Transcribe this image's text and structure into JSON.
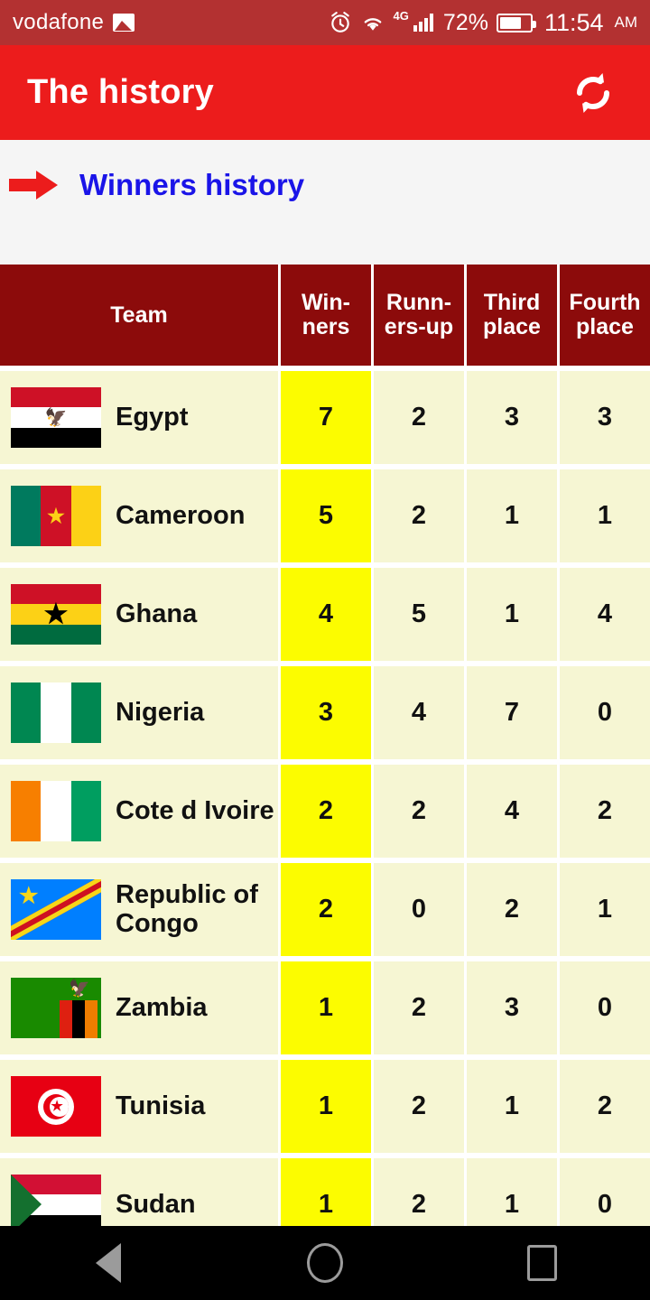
{
  "status_bar": {
    "carrier": "vodafone",
    "photo_icon": "photo-icon",
    "alarm_icon": "alarm-icon",
    "wifi_icon": "wifi-icon",
    "network_type": "4G",
    "signal_icon": "signal-bars-icon",
    "battery_percent": "72%",
    "battery_icon": "battery-icon",
    "time": "11:54",
    "meridiem": "AM"
  },
  "app_bar": {
    "title": "The history",
    "refresh_icon": "refresh-icon"
  },
  "section": {
    "arrow_icon": "right-arrow-icon",
    "title": "Winners history",
    "title_color": "#1a14e8",
    "arrow_color": "#ec1c1c"
  },
  "colors": {
    "status_bar": "#b33131",
    "app_bar": "#ec1c1c",
    "table_header": "#8c0b0b",
    "cell_bg": "#f6f6d3",
    "winners_cell_bg": "#fcfc00"
  },
  "table": {
    "headers": [
      "Team",
      "Win-ners",
      "Runn-ers-up",
      "Third place",
      "Fourth place"
    ],
    "rows": [
      {
        "team": "Egypt",
        "flag": "flag-egypt",
        "winners": "7",
        "runners_up": "2",
        "third": "3",
        "fourth": "3"
      },
      {
        "team": "Cameroon",
        "flag": "flag-cameroon",
        "winners": "5",
        "runners_up": "2",
        "third": "1",
        "fourth": "1"
      },
      {
        "team": "Ghana",
        "flag": "flag-ghana",
        "winners": "4",
        "runners_up": "5",
        "third": "1",
        "fourth": "4"
      },
      {
        "team": "Nigeria",
        "flag": "flag-nigeria",
        "winners": "3",
        "runners_up": "4",
        "third": "7",
        "fourth": "0"
      },
      {
        "team": "Cote d Ivoire",
        "flag": "flag-ivory-coast",
        "winners": "2",
        "runners_up": "2",
        "third": "4",
        "fourth": "2"
      },
      {
        "team": "Republic of Congo",
        "flag": "flag-dr-congo",
        "winners": "2",
        "runners_up": "0",
        "third": "2",
        "fourth": "1"
      },
      {
        "team": "Zambia",
        "flag": "flag-zambia",
        "winners": "1",
        "runners_up": "2",
        "third": "3",
        "fourth": "0"
      },
      {
        "team": "Tunisia",
        "flag": "flag-tunisia",
        "winners": "1",
        "runners_up": "2",
        "third": "1",
        "fourth": "2"
      },
      {
        "team": "Sudan",
        "flag": "flag-sudan",
        "winners": "1",
        "runners_up": "2",
        "third": "1",
        "fourth": "0"
      }
    ]
  },
  "nav_bar": {
    "back_icon": "back-triangle-icon",
    "home_icon": "home-circle-icon",
    "recents_icon": "recents-square-icon"
  }
}
